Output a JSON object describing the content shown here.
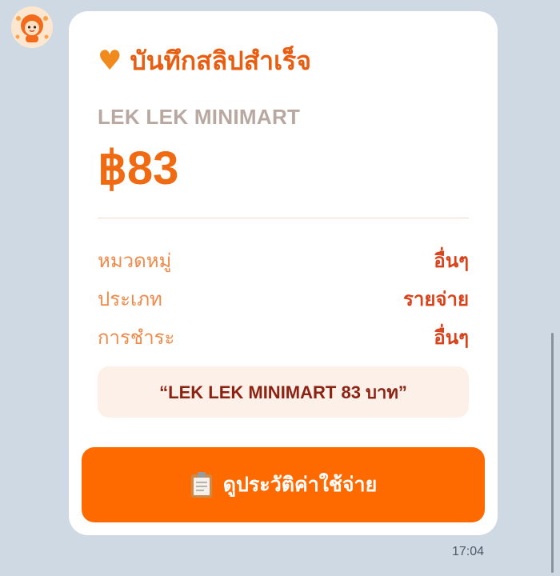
{
  "message": {
    "card": {
      "title": "บันทึกสลิปสำเร็จ",
      "title_icon": "orange-heart-icon",
      "store_name": "LEK LEK MINIMART",
      "amount": "฿83",
      "details": [
        {
          "label": "หมวดหมู่",
          "value": "อื่นๆ"
        },
        {
          "label": "ประเภท",
          "value": "รายจ่าย"
        },
        {
          "label": "การชำระ",
          "value": "อื่นๆ"
        }
      ],
      "quote": "“LEK LEK MINIMART 83 บาท”",
      "action_button": {
        "icon": "clipboard-icon",
        "label": "ดูประวัติค่าใช้จ่าย"
      }
    },
    "timestamp": "17:04"
  },
  "colors": {
    "accent": "#ff6a00",
    "title": "#e85d0f",
    "value_text": "#d8431c",
    "label_text": "#f08a4a",
    "background": "#cfd9e3"
  }
}
